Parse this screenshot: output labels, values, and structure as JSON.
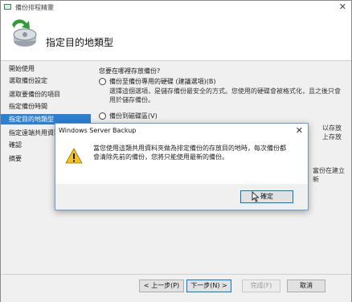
{
  "window": {
    "title": "備份排程精靈",
    "close_glyph": "✕"
  },
  "header": {
    "title": "指定目的地類型",
    "icon": "backup-schedule-icon"
  },
  "nav": {
    "items": [
      {
        "label": "開始使用",
        "active": false
      },
      {
        "label": "選取備份設定",
        "active": false
      },
      {
        "label": "選取要備份的項目",
        "active": false
      },
      {
        "label": "指定備份時間",
        "active": false
      },
      {
        "label": "指定目的地類型",
        "active": true
      },
      {
        "label": "指定遠端共用資料夾",
        "active": false
      },
      {
        "label": "確認",
        "active": false
      },
      {
        "label": "摘要",
        "active": false
      }
    ]
  },
  "content": {
    "question": "您要在哪裡存放備份?",
    "option1_label": "備份至備份專用的硬碟 (建議選項)(B)",
    "option1_desc": "選擇這個選項，是儲存備份最安全的方式。您使用的硬碟會被格式化，且之後只會用於儲存備份。",
    "option2_label": "備份到磁碟區(V)",
    "peek1": "以存放",
    "peek2": "上存放",
    "peek3": "富份在建立新"
  },
  "footer": {
    "back": "< 上一步(P)",
    "next": "下一步(N) >",
    "finish": "完成(F)",
    "cancel": "取消"
  },
  "dialog": {
    "title": "Windows Server Backup",
    "close_glyph": "✕",
    "message": "當您使用這類共用資料夾做為排定備份的存放目的地時，每次備份都會清除先前的備份，您將只能使用最新的備份。",
    "ok": "確定"
  }
}
